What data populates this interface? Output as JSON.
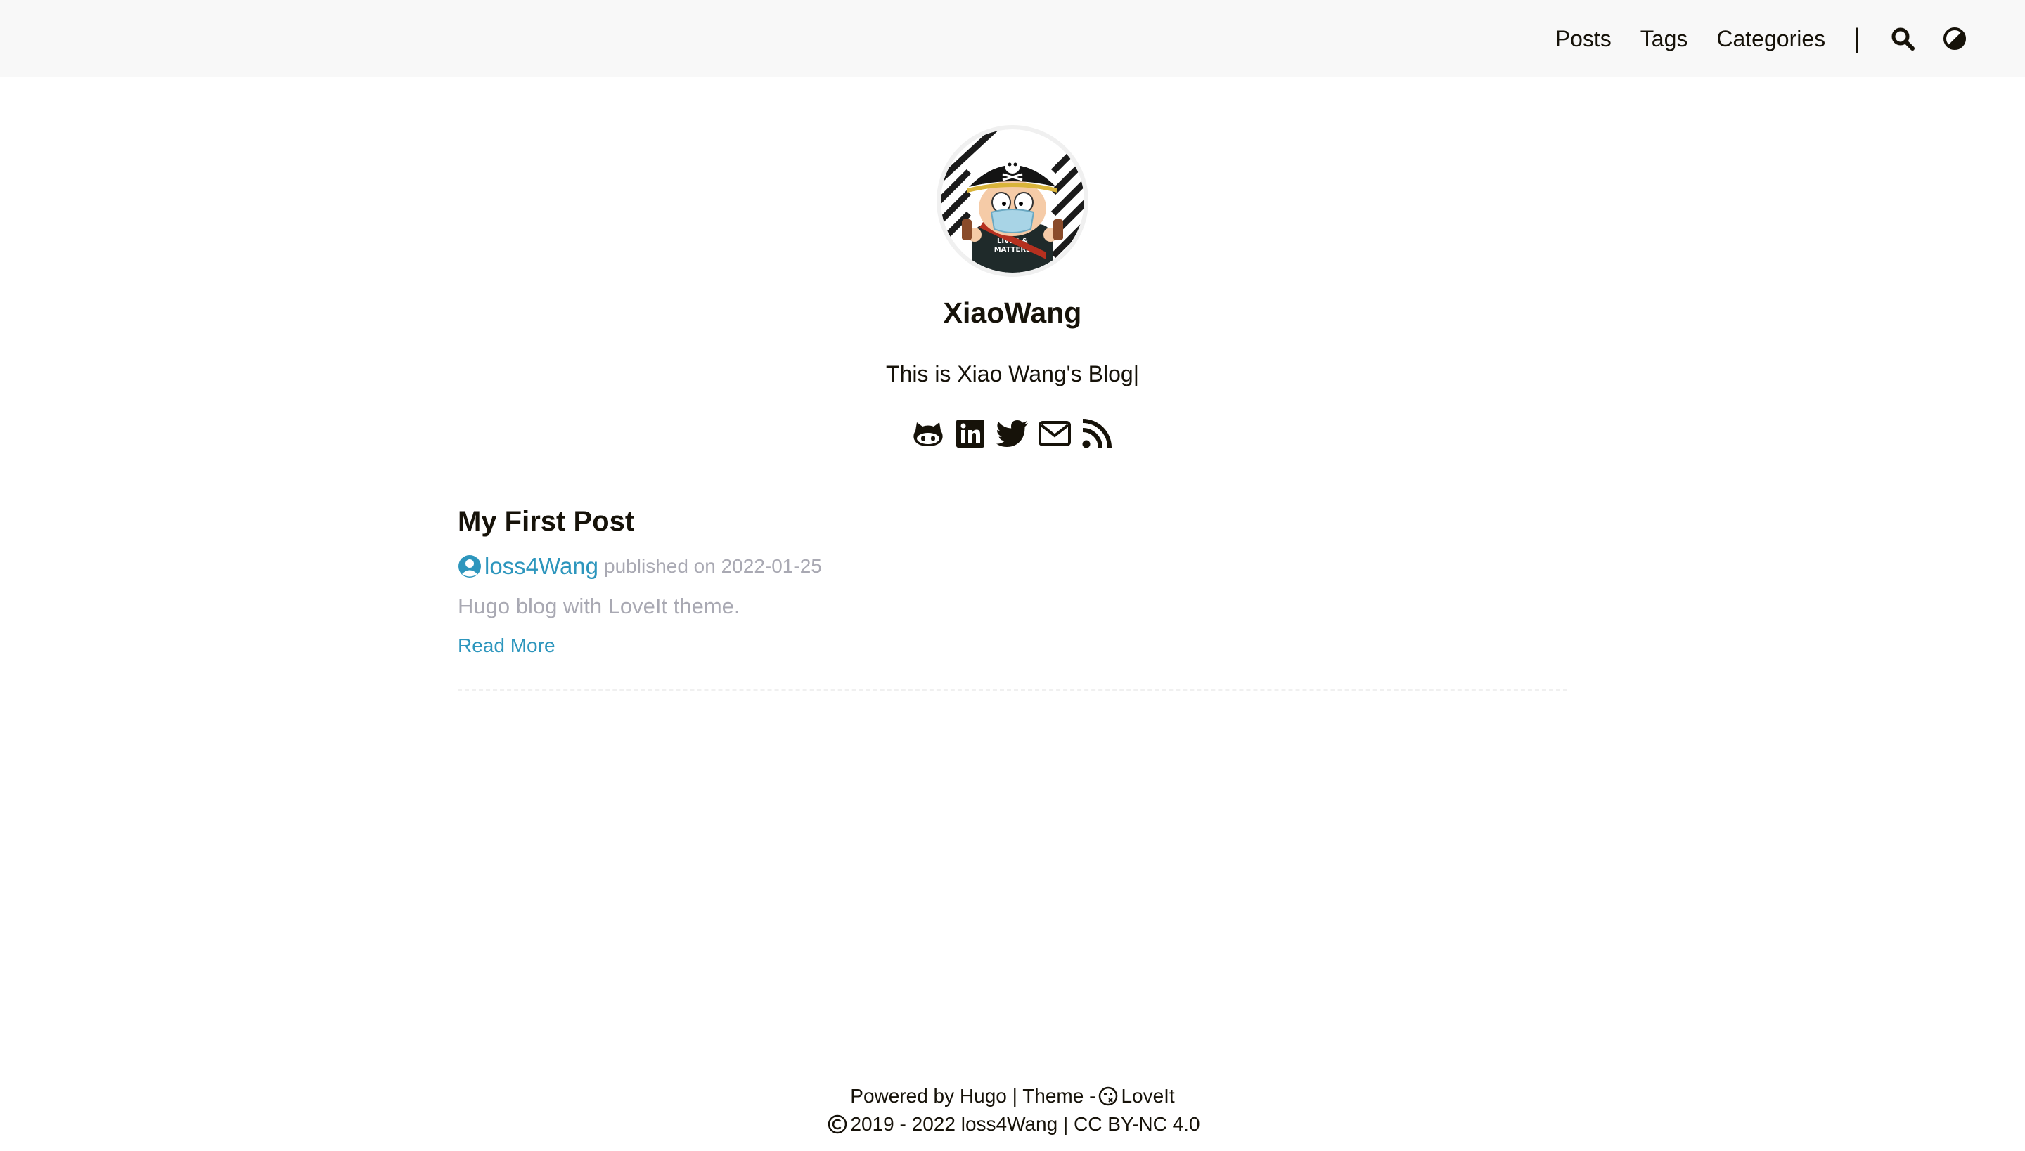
{
  "header": {
    "nav": [
      {
        "label": "Posts"
      },
      {
        "label": "Tags"
      },
      {
        "label": "Categories"
      }
    ],
    "separator": "|",
    "icons": [
      "search-icon",
      "theme-switch-icon"
    ]
  },
  "profile": {
    "avatar_icon": "avatar-cartoon-pirate",
    "title": "XiaoWang",
    "subtitle": "This is Xiao Wang's Blog|",
    "social_icons": [
      "github-icon",
      "linkedin-icon",
      "twitter-icon",
      "email-icon",
      "rss-icon"
    ]
  },
  "post": {
    "title": "My First Post",
    "author": "loss4Wang",
    "meta": "published on 2022-01-25",
    "content": "Hugo blog with LoveIt theme.",
    "read_more": "Read More"
  },
  "footer": {
    "powered_by": "Powered by",
    "hugo": "Hugo",
    "theme_sep": "| Theme -",
    "theme_name": "LoveIt",
    "years": "2019 - 2022",
    "owner": "loss4Wang",
    "license_sep": "|",
    "license": "CC BY-NC 4.0"
  },
  "colors": {
    "accent": "#2d96bd",
    "text": "#161209",
    "muted": "#a9a9b3",
    "header_bg": "#f8f8f8"
  }
}
